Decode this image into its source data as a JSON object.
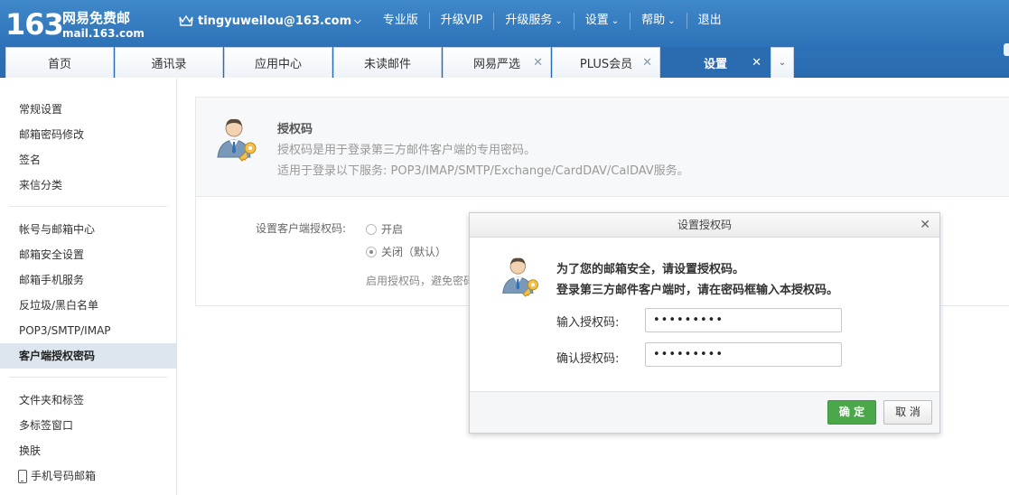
{
  "brand": {
    "number": "163",
    "name": "网易免费邮",
    "domain": "mail.163.com"
  },
  "topnav": {
    "user": "tingyuweilou@163.com",
    "items": [
      "专业版",
      "升级VIP",
      "升级服务",
      "设置",
      "帮助",
      "退出"
    ]
  },
  "tabs": [
    {
      "label": "首页",
      "closable": false
    },
    {
      "label": "通讯录",
      "closable": false
    },
    {
      "label": "应用中心",
      "closable": false
    },
    {
      "label": "未读邮件",
      "closable": false
    },
    {
      "label": "网易严选",
      "closable": true
    },
    {
      "label": "PLUS会员",
      "closable": true
    },
    {
      "label": "设置",
      "closable": true,
      "active": true
    }
  ],
  "sidebar": {
    "group1": [
      "常规设置",
      "邮箱密码修改",
      "签名",
      "来信分类"
    ],
    "group2": [
      "帐号与邮箱中心",
      "邮箱安全设置",
      "邮箱手机服务",
      "反垃圾/黑白名单",
      "POP3/SMTP/IMAP",
      "客户端授权密码"
    ],
    "group3": [
      "文件夹和标签",
      "多标签窗口",
      "换肤",
      "手机号码邮箱"
    ],
    "active": "客户端授权密码"
  },
  "card": {
    "title": "授权码",
    "desc1": "授权码是用于登录第三方邮件客户端的专用密码。",
    "desc2": "适用于登录以下服务: POP3/IMAP/SMTP/Exchange/CardDAV/CalDAV服务。",
    "form_label": "设置客户端授权码:",
    "option_on": "开启",
    "option_off": "关闭（默认）",
    "note": "启用授权码，避免密码"
  },
  "dialog": {
    "title": "设置授权码",
    "line1": "为了您的邮箱安全，请设置授权码。",
    "line2": "登录第三方邮件客户端时，请在密码框输入本授权码。",
    "input1_label": "输入授权码:",
    "input1_value": "•••••••••",
    "input2_label": "确认授权码:",
    "input2_value": "•••••••••",
    "ok": "确 定",
    "cancel": "取 消"
  },
  "colors": {
    "header": "#2d72b8",
    "active_tab": "#2b6cb0",
    "ok_button": "#4aa84a"
  }
}
